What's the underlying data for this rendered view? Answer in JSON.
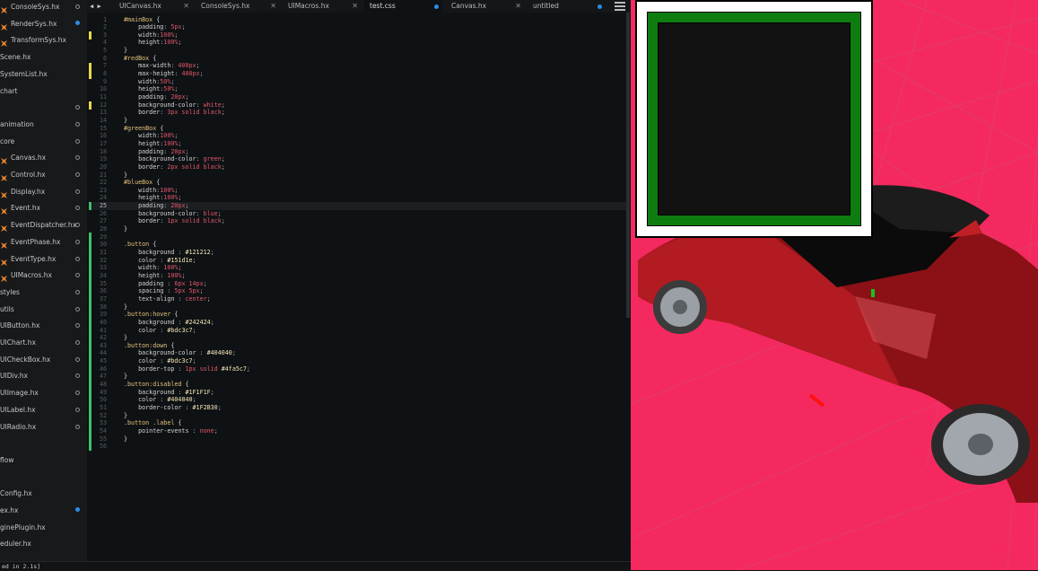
{
  "sidebar": {
    "items": [
      {
        "label": "ConsoleSys.hx",
        "icon": "haxe-file-icon",
        "state": "circle"
      },
      {
        "label": "RenderSys.hx",
        "icon": "haxe-file-icon",
        "state": "dot"
      },
      {
        "label": "TransformSys.hx",
        "icon": "haxe-file-icon",
        "state": ""
      },
      {
        "label": "Scene.hx",
        "icon": "",
        "state": ""
      },
      {
        "label": "SystemList.hx",
        "icon": "",
        "state": ""
      },
      {
        "label": "chart",
        "icon": "",
        "state": ""
      },
      {
        "label": "",
        "icon": "",
        "state": "circle"
      },
      {
        "label": "animation",
        "icon": "",
        "state": "circle"
      },
      {
        "label": "core",
        "icon": "",
        "state": "circle"
      },
      {
        "label": "Canvas.hx",
        "icon": "haxe-file-icon",
        "state": "circle"
      },
      {
        "label": "Control.hx",
        "icon": "haxe-file-icon",
        "state": "circle"
      },
      {
        "label": "Display.hx",
        "icon": "haxe-file-icon",
        "state": "circle"
      },
      {
        "label": "Event.hx",
        "icon": "haxe-file-icon",
        "state": "circle"
      },
      {
        "label": "EventDispatcher.hx",
        "icon": "haxe-file-icon",
        "state": "circle"
      },
      {
        "label": "EventPhase.hx",
        "icon": "haxe-file-icon",
        "state": "circle"
      },
      {
        "label": "EventType.hx",
        "icon": "haxe-file-icon",
        "state": "circle"
      },
      {
        "label": "UIMacros.hx",
        "icon": "haxe-file-icon",
        "state": "circle"
      },
      {
        "label": "styles",
        "icon": "",
        "state": "circle"
      },
      {
        "label": "utils",
        "icon": "",
        "state": "circle"
      },
      {
        "label": "UIButton.hx",
        "icon": "",
        "state": "circle"
      },
      {
        "label": "UIChart.hx",
        "icon": "",
        "state": "circle"
      },
      {
        "label": "UICheckBox.hx",
        "icon": "",
        "state": "circle"
      },
      {
        "label": "UIDiv.hx",
        "icon": "",
        "state": "circle"
      },
      {
        "label": "UIImage.hx",
        "icon": "",
        "state": "circle"
      },
      {
        "label": "UILabel.hx",
        "icon": "",
        "state": "circle"
      },
      {
        "label": "UIRadio.hx",
        "icon": "",
        "state": "circle"
      },
      {
        "label": "",
        "icon": "",
        "state": ""
      },
      {
        "label": "flow",
        "icon": "",
        "state": ""
      },
      {
        "label": "",
        "icon": "",
        "state": ""
      },
      {
        "label": "Config.hx",
        "icon": "",
        "state": ""
      },
      {
        "label": "ex.hx",
        "icon": "",
        "state": "dot"
      },
      {
        "label": "ginePlugin.hx",
        "icon": "",
        "state": ""
      },
      {
        "label": "eduler.hx",
        "icon": "",
        "state": ""
      }
    ]
  },
  "tabs": [
    {
      "label": "UICanvas.hx",
      "indicator": "close",
      "active": false
    },
    {
      "label": "ConsoleSys.hx",
      "indicator": "close",
      "active": false
    },
    {
      "label": "UIMacros.hx",
      "indicator": "close",
      "active": false
    },
    {
      "label": "test.css",
      "indicator": "dot",
      "active": true
    },
    {
      "label": "Canvas.hx",
      "indicator": "close",
      "active": false
    },
    {
      "label": "untitled",
      "indicator": "dot",
      "active": false
    }
  ],
  "tab_nav": {
    "back": "◀",
    "forward": "▶"
  },
  "editor": {
    "current_line": 25,
    "lines": [
      [
        [
          "#mainBox",
          "sel"
        ],
        [
          " {",
          "brace"
        ]
      ],
      [
        [
          "    padding",
          "prop"
        ],
        [
          ": ",
          "punc"
        ],
        [
          "5px",
          "val"
        ],
        [
          ";",
          "punc"
        ]
      ],
      [
        [
          "    width",
          "prop"
        ],
        [
          ":",
          "punc"
        ],
        [
          "100%",
          "val"
        ],
        [
          ";",
          "punc"
        ]
      ],
      [
        [
          "    height",
          "prop"
        ],
        [
          ":",
          "punc"
        ],
        [
          "100%",
          "val"
        ],
        [
          ";",
          "punc"
        ]
      ],
      [
        [
          "}",
          "brace"
        ]
      ],
      [
        [
          "#redBox",
          "sel"
        ],
        [
          " {",
          "brace"
        ]
      ],
      [
        [
          "    max-width",
          "prop"
        ],
        [
          ": ",
          "punc"
        ],
        [
          "400px",
          "val"
        ],
        [
          ";",
          "punc"
        ]
      ],
      [
        [
          "    max-height",
          "prop"
        ],
        [
          ": ",
          "punc"
        ],
        [
          "400px",
          "val"
        ],
        [
          ";",
          "punc"
        ]
      ],
      [
        [
          "    width",
          "prop"
        ],
        [
          ":",
          "punc"
        ],
        [
          "50%",
          "val"
        ],
        [
          ";",
          "punc"
        ]
      ],
      [
        [
          "    height",
          "prop"
        ],
        [
          ":",
          "punc"
        ],
        [
          "50%",
          "val"
        ],
        [
          ";",
          "punc"
        ]
      ],
      [
        [
          "    padding",
          "prop"
        ],
        [
          ": ",
          "punc"
        ],
        [
          "20px",
          "val"
        ],
        [
          ";",
          "punc"
        ]
      ],
      [
        [
          "    background-color",
          "prop"
        ],
        [
          ": ",
          "punc"
        ],
        [
          "white",
          "val"
        ],
        [
          ";",
          "punc"
        ]
      ],
      [
        [
          "    border",
          "prop"
        ],
        [
          ": ",
          "punc"
        ],
        [
          "3px solid black",
          "val"
        ],
        [
          ";",
          "punc"
        ]
      ],
      [
        [
          "}",
          "brace"
        ]
      ],
      [
        [
          "#greenBox",
          "sel"
        ],
        [
          " {",
          "brace"
        ]
      ],
      [
        [
          "    width",
          "prop"
        ],
        [
          ":",
          "punc"
        ],
        [
          "100%",
          "val"
        ],
        [
          ";",
          "punc"
        ]
      ],
      [
        [
          "    height",
          "prop"
        ],
        [
          ":",
          "punc"
        ],
        [
          "100%",
          "val"
        ],
        [
          ";",
          "punc"
        ]
      ],
      [
        [
          "    padding",
          "prop"
        ],
        [
          ": ",
          "punc"
        ],
        [
          "20px",
          "val"
        ],
        [
          ";",
          "punc"
        ]
      ],
      [
        [
          "    background-color",
          "prop"
        ],
        [
          ": ",
          "punc"
        ],
        [
          "green",
          "val"
        ],
        [
          ";",
          "punc"
        ]
      ],
      [
        [
          "    border",
          "prop"
        ],
        [
          ": ",
          "punc"
        ],
        [
          "2px solid black",
          "val"
        ],
        [
          ";",
          "punc"
        ]
      ],
      [
        [
          "}",
          "brace"
        ]
      ],
      [
        [
          "#blueBox",
          "sel"
        ],
        [
          " {",
          "brace"
        ]
      ],
      [
        [
          "    width",
          "prop"
        ],
        [
          ":",
          "punc"
        ],
        [
          "100%",
          "val"
        ],
        [
          ";",
          "punc"
        ]
      ],
      [
        [
          "    height",
          "prop"
        ],
        [
          ":",
          "punc"
        ],
        [
          "100%",
          "val"
        ],
        [
          ";",
          "punc"
        ]
      ],
      [
        [
          "    padding",
          "prop"
        ],
        [
          ": ",
          "punc"
        ],
        [
          "20px",
          "val"
        ],
        [
          ";",
          "punc"
        ]
      ],
      [
        [
          "    background-color",
          "prop"
        ],
        [
          ": ",
          "punc"
        ],
        [
          "blue",
          "val"
        ],
        [
          ";",
          "punc"
        ]
      ],
      [
        [
          "    border",
          "prop"
        ],
        [
          ": ",
          "punc"
        ],
        [
          "1px solid black",
          "val"
        ],
        [
          ";",
          "punc"
        ]
      ],
      [
        [
          "}",
          "brace"
        ]
      ],
      [],
      [
        [
          ".button",
          "sel"
        ],
        [
          " {",
          "brace"
        ]
      ],
      [
        [
          "    background",
          "prop"
        ],
        [
          " : ",
          "punc"
        ],
        [
          "#121212",
          "hex"
        ],
        [
          ";",
          "punc"
        ]
      ],
      [
        [
          "    color",
          "prop"
        ],
        [
          " : ",
          "punc"
        ],
        [
          "#151d1e",
          "hex"
        ],
        [
          ";",
          "punc"
        ]
      ],
      [
        [
          "    width",
          "prop"
        ],
        [
          ": ",
          "punc"
        ],
        [
          "100%",
          "val"
        ],
        [
          ";",
          "punc"
        ]
      ],
      [
        [
          "    height",
          "prop"
        ],
        [
          ": ",
          "punc"
        ],
        [
          "100%",
          "val"
        ],
        [
          ";",
          "punc"
        ]
      ],
      [
        [
          "    padding",
          "prop"
        ],
        [
          " : ",
          "punc"
        ],
        [
          "6px 14px",
          "val"
        ],
        [
          ";",
          "punc"
        ]
      ],
      [
        [
          "    spacing",
          "prop"
        ],
        [
          " : ",
          "punc"
        ],
        [
          "5px 5px",
          "val"
        ],
        [
          ";",
          "punc"
        ]
      ],
      [
        [
          "    text-align",
          "prop"
        ],
        [
          " : ",
          "punc"
        ],
        [
          "center",
          "val"
        ],
        [
          ";",
          "punc"
        ]
      ],
      [
        [
          "}",
          "brace"
        ]
      ],
      [
        [
          ".button:hover",
          "sel"
        ],
        [
          " {",
          "brace"
        ]
      ],
      [
        [
          "    background",
          "prop"
        ],
        [
          " : ",
          "punc"
        ],
        [
          "#242424",
          "hex"
        ],
        [
          ";",
          "punc"
        ]
      ],
      [
        [
          "    color",
          "prop"
        ],
        [
          " : ",
          "punc"
        ],
        [
          "#bdc3c7",
          "hex"
        ],
        [
          ";",
          "punc"
        ]
      ],
      [
        [
          "}",
          "brace"
        ]
      ],
      [
        [
          ".button:down",
          "sel"
        ],
        [
          " {",
          "brace"
        ]
      ],
      [
        [
          "    background-color",
          "prop"
        ],
        [
          " : ",
          "punc"
        ],
        [
          "#404040",
          "hex"
        ],
        [
          ";",
          "punc"
        ]
      ],
      [
        [
          "    color",
          "prop"
        ],
        [
          " : ",
          "punc"
        ],
        [
          "#bdc3c7",
          "hex"
        ],
        [
          ";",
          "punc"
        ]
      ],
      [
        [
          "    border-top",
          "prop"
        ],
        [
          " : ",
          "punc"
        ],
        [
          "1px solid ",
          "val"
        ],
        [
          "#4fa5c7",
          "hex"
        ],
        [
          ";",
          "punc"
        ]
      ],
      [
        [
          "}",
          "brace"
        ]
      ],
      [
        [
          ".button:disabled",
          "sel"
        ],
        [
          " {",
          "brace"
        ]
      ],
      [
        [
          "    background",
          "prop"
        ],
        [
          " : ",
          "punc"
        ],
        [
          "#1F1F1F",
          "hex"
        ],
        [
          ";",
          "punc"
        ]
      ],
      [
        [
          "    color",
          "prop"
        ],
        [
          " : ",
          "punc"
        ],
        [
          "#404040",
          "hex"
        ],
        [
          ";",
          "punc"
        ]
      ],
      [
        [
          "    border-color",
          "prop"
        ],
        [
          " : ",
          "punc"
        ],
        [
          "#1F2B30",
          "hex"
        ],
        [
          ";",
          "punc"
        ]
      ],
      [
        [
          "}",
          "brace"
        ]
      ],
      [
        [
          ".button .label",
          "sel"
        ],
        [
          " {",
          "brace"
        ]
      ],
      [
        [
          "    pointer-events",
          "prop"
        ],
        [
          " : ",
          "punc"
        ],
        [
          "none",
          "val"
        ],
        [
          ";",
          "punc"
        ]
      ],
      [
        [
          "}",
          "brace"
        ]
      ],
      []
    ]
  },
  "status": {
    "text": "ed in 2.1s]"
  },
  "colors": {
    "accent": "#2d8ce6",
    "modified_marker": "#e6d84a",
    "added_marker": "#3fbf6a",
    "viewport_background": "#f4295f",
    "red_box": "#ffffff",
    "green_box": "#0e7d10",
    "blue_box": "#121212",
    "car_body": "#a3171d"
  }
}
